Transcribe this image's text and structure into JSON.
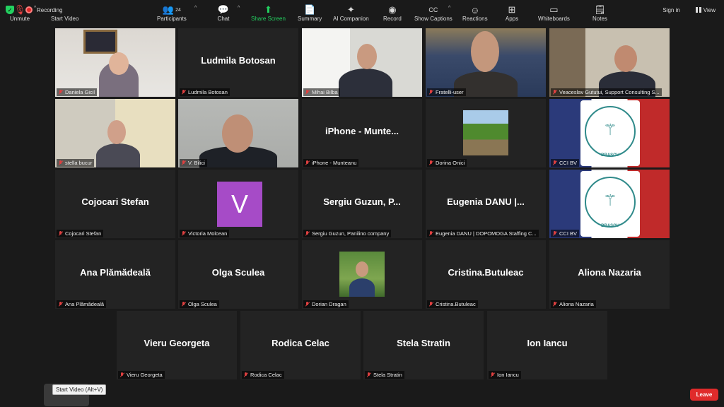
{
  "topbar": {
    "recording": "Recording",
    "sign_in": "Sign in",
    "view": "View"
  },
  "tiles": [
    {
      "big": "",
      "name": "Daniela Gicil"
    },
    {
      "big": "Ludmila Botosan",
      "name": "Ludmila Botosan"
    },
    {
      "big": "",
      "name": "Mihai Bilba"
    },
    {
      "big": "",
      "name": "Fratelli-user"
    },
    {
      "big": "",
      "name": "Veaceslav Gututui, Support Consulting S..."
    },
    {
      "big": "",
      "name": "stella bucur"
    },
    {
      "big": "",
      "name": "V. Bilici"
    },
    {
      "big": "iPhone - Munte...",
      "name": "iPhone - Munteanu"
    },
    {
      "big": "",
      "name": "Dorina Onici"
    },
    {
      "big": "",
      "name": "CCI BV"
    },
    {
      "big": "Cojocari Stefan",
      "name": "Cojocari Stefan"
    },
    {
      "big": "",
      "name": "Victoria Molcean",
      "avatar": "V"
    },
    {
      "big": "Sergiu Guzun, P...",
      "name": "Sergiu Guzun, Panilino company"
    },
    {
      "big": "Eugenia DANU |...",
      "name": "Eugenia DANU | DOPOMOGA Staffing C..."
    },
    {
      "big": "",
      "name": "CCI BV"
    },
    {
      "big": "Ana Plămădeală",
      "name": "Ana Plămădeală"
    },
    {
      "big": "Olga Sculea",
      "name": "Olga Sculea"
    },
    {
      "big": "",
      "name": "Dorian Dragan"
    },
    {
      "big": "Cristina.Butuleac",
      "name": "Cristina.Butuleac"
    },
    {
      "big": "Aliona Nazaria",
      "name": "Aliona Nazaria"
    },
    {
      "big": "Vieru Georgeta",
      "name": "Vieru Georgeta"
    },
    {
      "big": "Rodica Celac",
      "name": "Rodica Celac"
    },
    {
      "big": "Stela Stratin",
      "name": "Stela Stratin"
    },
    {
      "big": "Ion Iancu",
      "name": "Ion Iancu"
    }
  ],
  "logo": {
    "top_text": "CAMERA DE COMERȚ ȘI INDUSTRIE",
    "bottom_text": "BRAȘOV",
    "year": "1850"
  },
  "toolbar": {
    "unmute": "Unmute",
    "start_video": "Start Video",
    "tooltip": "Start Video (Alt+V)",
    "participants": "Participants",
    "participants_count": "24",
    "chat": "Chat",
    "share_screen": "Share Screen",
    "summary": "Summary",
    "ai_companion": "AI Companion",
    "record": "Record",
    "show_captions": "Show Captions",
    "reactions": "Reactions",
    "apps": "Apps",
    "whiteboards": "Whiteboards",
    "notes": "Notes",
    "leave": "Leave"
  }
}
